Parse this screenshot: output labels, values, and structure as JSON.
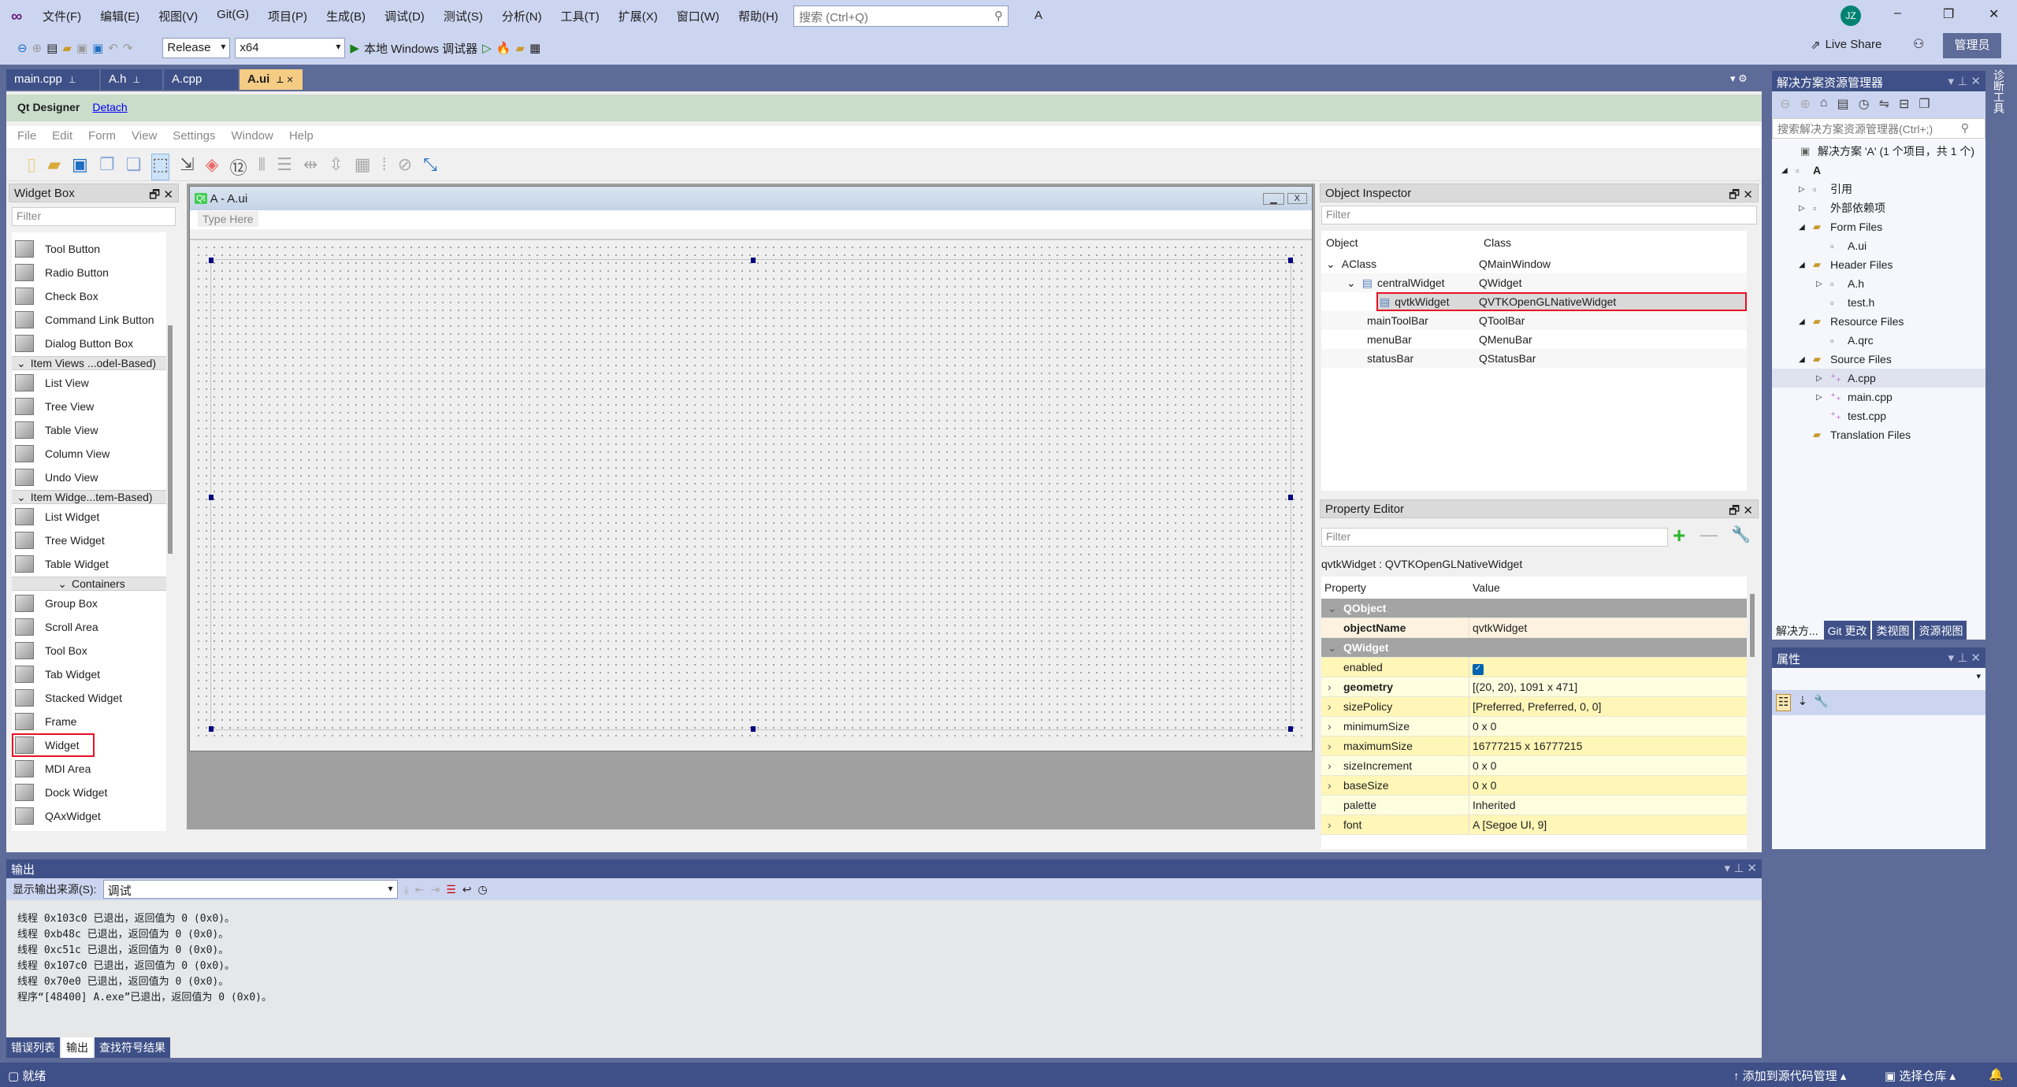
{
  "titlebar": {
    "menus": [
      "文件(F)",
      "编辑(E)",
      "视图(V)",
      "Git(G)",
      "项目(P)",
      "生成(B)",
      "调试(D)",
      "测试(S)",
      "分析(N)",
      "工具(T)",
      "扩展(X)",
      "窗口(W)",
      "帮助(H)"
    ],
    "search_placeholder": "搜索 (Ctrl+Q)",
    "solution_name": "A",
    "avatar": "JZ",
    "live_share": "Live Share",
    "admin": "管理员"
  },
  "toolbar": {
    "config": "Release",
    "platform": "x64",
    "run": "本地 Windows 调试器"
  },
  "doc_tabs": [
    {
      "label": "main.cpp"
    },
    {
      "label": "A.h"
    },
    {
      "label": "A.cpp"
    },
    {
      "label": "A.ui",
      "active": true
    }
  ],
  "qt": {
    "title": "Qt Designer",
    "detach": "Detach",
    "menu": [
      "File",
      "Edit",
      "Form",
      "View",
      "Settings",
      "Window",
      "Help"
    ]
  },
  "widget_box": {
    "title": "Widget Box",
    "filter": "Filter",
    "items": [
      {
        "label": "Tool Button"
      },
      {
        "label": "Radio Button"
      },
      {
        "label": "Check Box"
      },
      {
        "label": "Command Link Button"
      },
      {
        "label": "Dialog Button Box"
      },
      {
        "category": "Item Views ...odel-Based)"
      },
      {
        "label": "List View"
      },
      {
        "label": "Tree View"
      },
      {
        "label": "Table View"
      },
      {
        "label": "Column View"
      },
      {
        "label": "Undo View"
      },
      {
        "category": "Item Widge...tem-Based)"
      },
      {
        "label": "List Widget"
      },
      {
        "label": "Tree Widget"
      },
      {
        "label": "Table Widget"
      },
      {
        "category": "Containers"
      },
      {
        "label": "Group Box"
      },
      {
        "label": "Scroll Area"
      },
      {
        "label": "Tool Box"
      },
      {
        "label": "Tab Widget"
      },
      {
        "label": "Stacked Widget"
      },
      {
        "label": "Frame"
      },
      {
        "label": "Widget",
        "highlighted": true
      },
      {
        "label": "MDI Area"
      },
      {
        "label": "Dock Widget"
      },
      {
        "label": "QAxWidget"
      }
    ]
  },
  "form": {
    "title": "A - A.ui",
    "type_here": "Type Here"
  },
  "object_inspector": {
    "title": "Object Inspector",
    "filter": "Filter",
    "col_object": "Object",
    "col_class": "Class",
    "rows": [
      {
        "object": "AClass",
        "class": "QMainWindow",
        "indent": 0,
        "expand": "v"
      },
      {
        "object": "centralWidget",
        "class": "QWidget",
        "indent": 1,
        "expand": "v"
      },
      {
        "object": "qvtkWidget",
        "class": "QVTKOpenGLNativeWidget",
        "indent": 2,
        "selected": true
      },
      {
        "object": "mainToolBar",
        "class": "QToolBar",
        "indent": 1
      },
      {
        "object": "menuBar",
        "class": "QMenuBar",
        "indent": 1
      },
      {
        "object": "statusBar",
        "class": "QStatusBar",
        "indent": 1
      }
    ]
  },
  "property_editor": {
    "title": "Property Editor",
    "filter": "Filter",
    "subject": "qvtkWidget : QVTKOpenGLNativeWidget",
    "col_property": "Property",
    "col_value": "Value",
    "rows": [
      {
        "group": "QObject"
      },
      {
        "name": "objectName",
        "value": "qvtkWidget",
        "bold": true
      },
      {
        "group": "QWidget"
      },
      {
        "name": "enabled",
        "checked": true
      },
      {
        "name": "geometry",
        "value": "[(20, 20), 1091 x 471]",
        "bold": true,
        "expandable": true
      },
      {
        "name": "sizePolicy",
        "value": "[Preferred, Preferred, 0, 0]",
        "expandable": true
      },
      {
        "name": "minimumSize",
        "value": "0 x 0",
        "expandable": true
      },
      {
        "name": "maximumSize",
        "value": "16777215 x 16777215",
        "expandable": true
      },
      {
        "name": "sizeIncrement",
        "value": "0 x 0",
        "expandable": true
      },
      {
        "name": "baseSize",
        "value": "0 x 0",
        "expandable": true
      },
      {
        "name": "palette",
        "value": "Inherited"
      },
      {
        "name": "font",
        "value": "A  [Segoe UI, 9]",
        "expandable": true
      }
    ]
  },
  "solution_explorer": {
    "title": "解决方案资源管理器",
    "search_placeholder": "搜索解决方案资源管理器(Ctrl+;)",
    "tree": [
      {
        "label": "解决方案 'A' (1 个项目，共 1 个)",
        "level": 0
      },
      {
        "label": "A",
        "level": 1,
        "arrow": "◢",
        "bold": true
      },
      {
        "label": "引用",
        "level": 2,
        "arrow": "▷"
      },
      {
        "label": "外部依赖项",
        "level": 2,
        "arrow": "▷"
      },
      {
        "label": "Form Files",
        "level": 2,
        "arrow": "◢"
      },
      {
        "label": "A.ui",
        "level": 3
      },
      {
        "label": "Header Files",
        "level": 2,
        "arrow": "◢"
      },
      {
        "label": "A.h",
        "level": 3,
        "arrow": "▷"
      },
      {
        "label": "test.h",
        "level": 3
      },
      {
        "label": "Resource Files",
        "level": 2,
        "arrow": "◢"
      },
      {
        "label": "A.qrc",
        "level": 3
      },
      {
        "label": "Source Files",
        "level": 2,
        "arrow": "◢"
      },
      {
        "label": "A.cpp",
        "level": 3,
        "arrow": "▷",
        "highlighted": true
      },
      {
        "label": "main.cpp",
        "level": 3,
        "arrow": "▷"
      },
      {
        "label": "test.cpp",
        "level": 3
      },
      {
        "label": "Translation Files",
        "level": 2
      }
    ],
    "tabs": [
      "解决方...",
      "Git 更改",
      "类视图",
      "资源视图"
    ]
  },
  "properties_panel": {
    "title": "属性"
  },
  "diagnostics": "诊断工具",
  "output": {
    "title": "输出",
    "source_label": "显示输出来源(S):",
    "source": "调试",
    "lines": [
      "线程 0x103c0 已退出，返回值为 0 (0x0)。",
      "线程 0xb48c 已退出，返回值为 0 (0x0)。",
      "线程 0xc51c 已退出，返回值为 0 (0x0)。",
      "线程 0x107c0 已退出，返回值为 0 (0x0)。",
      "线程 0x70e0 已退出，返回值为 0 (0x0)。",
      "程序“[48400] A.exe”已退出，返回值为 0 (0x0)。"
    ],
    "tabs": [
      "错误列表",
      "输出",
      "查找符号结果"
    ]
  },
  "status": {
    "ready": "就绪",
    "source_control": "添加到源代码管理",
    "repo": "选择仓库"
  }
}
